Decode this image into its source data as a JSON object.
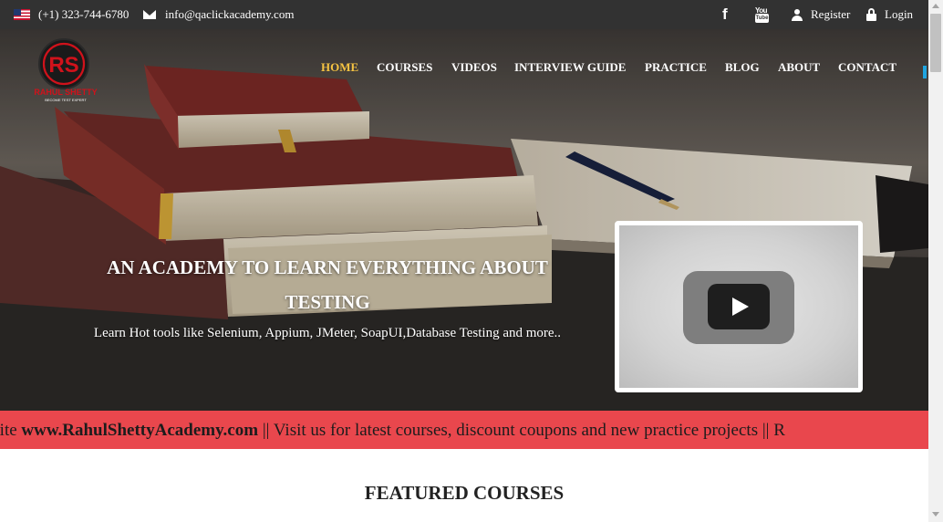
{
  "topbar": {
    "phone": "(+1) 323-744-6780",
    "email": "info@qaclickacademy.com",
    "facebook_glyph": "f",
    "youtube_glyph_top": "You",
    "youtube_glyph_box": "Tube",
    "register_label": "Register",
    "login_label": "Login"
  },
  "logo": {
    "monogram": "RS",
    "name": "RAHUL SHETTY",
    "tagline": "BECOME TEST EXPERT"
  },
  "nav": {
    "items": [
      {
        "label": "HOME",
        "active": true
      },
      {
        "label": "COURSES"
      },
      {
        "label": "VIDEOS"
      },
      {
        "label": "INTERVIEW GUIDE"
      },
      {
        "label": "PRACTICE"
      },
      {
        "label": "BLOG"
      },
      {
        "label": "ABOUT"
      },
      {
        "label": "CONTACT"
      }
    ]
  },
  "hero": {
    "title_line1": "AN ACADEMY TO LEARN EVERYTHING ABOUT",
    "title_line2": "TESTING",
    "subtitle": "Learn Hot tools like Selenium, Appium, JMeter, SoapUI,Database Testing and more.."
  },
  "marquee": {
    "text_before": "ed to new website ",
    "link": "www.RahulShettyAcademy.com",
    "text_after": " || Visit us for latest courses, discount coupons and new practice projects || R"
  },
  "featured": {
    "heading": "FEATURED COURSES"
  },
  "colors": {
    "topbar_bg": "#323232",
    "nav_active": "#f5c342",
    "marquee_bg": "#e9474d",
    "logo_red": "#d0121b"
  }
}
